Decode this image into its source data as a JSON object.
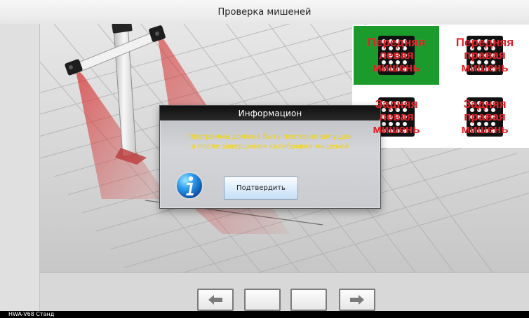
{
  "window": {
    "title": "Проверка мишеней"
  },
  "targets": [
    {
      "label": "Передняя\nлевая\nмишень",
      "status": "active",
      "color": "#1c9b2d"
    },
    {
      "label": "Передняя\nправая\nмишень",
      "status": "inactive",
      "color": "#ffffff"
    },
    {
      "label": "Задняя\nлевая\nмишень",
      "status": "inactive",
      "color": "#ffffff"
    },
    {
      "label": "Задняя\nправая\nмишень",
      "status": "inactive",
      "color": "#ffffff"
    }
  ],
  "dialog": {
    "title": "Информацион",
    "message": "Программа должна быть повторно запущен\nа после завершения калибровки мишеней",
    "confirm_label": "Подтвердить",
    "icon": "info-icon"
  },
  "navigation": {
    "previous_icon": "arrow-left-icon",
    "next_icon": "arrow-right-icon"
  },
  "status": {
    "text": "HWA-V68  Станд"
  },
  "colors": {
    "target_text": "#e31e25",
    "dialog_text": "#f4d300",
    "beam": "#d93b3b"
  }
}
